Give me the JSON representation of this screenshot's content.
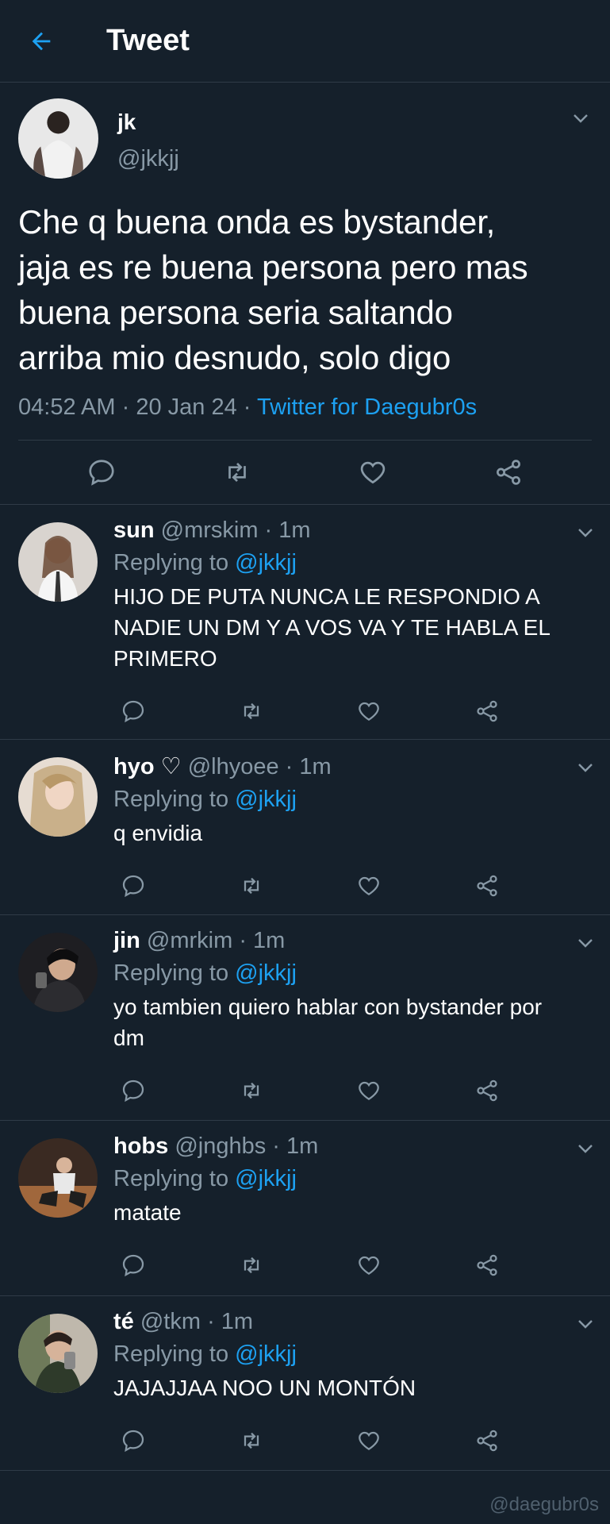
{
  "header": {
    "title": "Tweet"
  },
  "tweet": {
    "name": "jk",
    "handle": "@jkkjj",
    "text_lines": [
      "Che q buena onda es bystander,",
      "jaja es re buena persona pero mas",
      "buena persona seria saltando",
      "arriba mio desnudo, solo digo"
    ],
    "time": "04:52 AM",
    "date": "20 Jan 24",
    "source": "Twitter for Daegubr0s"
  },
  "replies": [
    {
      "name": "sun",
      "handle": "@mrskim",
      "time": "1m",
      "reply_prefix": "Replying to",
      "mention": "@jkkjj",
      "text_lines": [
        "HIJO DE PUTA NUNCA LE RESPONDIO A",
        "NADIE UN DM Y A VOS VA Y TE HABLA EL",
        "PRIMERO"
      ]
    },
    {
      "name": "hyo ♡",
      "handle": "@lhyoee",
      "time": "1m",
      "reply_prefix": "Replying to",
      "mention": "@jkkjj",
      "text_lines": [
        "q envidia"
      ]
    },
    {
      "name": "jin",
      "handle": "@mrkim",
      "time": "1m",
      "reply_prefix": "Replying to",
      "mention": "@jkkjj",
      "text_lines": [
        "yo tambien quiero hablar con bystander por",
        "dm"
      ]
    },
    {
      "name": "hobs",
      "handle": "@jnghbs",
      "time": "1m",
      "reply_prefix": "Replying to",
      "mention": "@jkkjj",
      "text_lines": [
        "matate"
      ]
    },
    {
      "name": "té",
      "handle": "@tkm",
      "time": "1m",
      "reply_prefix": "Replying to",
      "mention": "@jkkjj",
      "text_lines": [
        "JAJAJJAA NOO UN MONTÓN"
      ]
    }
  ],
  "watermark": "@daegubr0s",
  "colors": {
    "background": "#15202b",
    "accent": "#1da1f2",
    "secondary_text": "#8899a6",
    "divider": "#2f3b47"
  },
  "icons": [
    "back-arrow-icon",
    "chevron-down-icon",
    "reply-icon",
    "retweet-icon",
    "like-icon",
    "share-icon"
  ]
}
